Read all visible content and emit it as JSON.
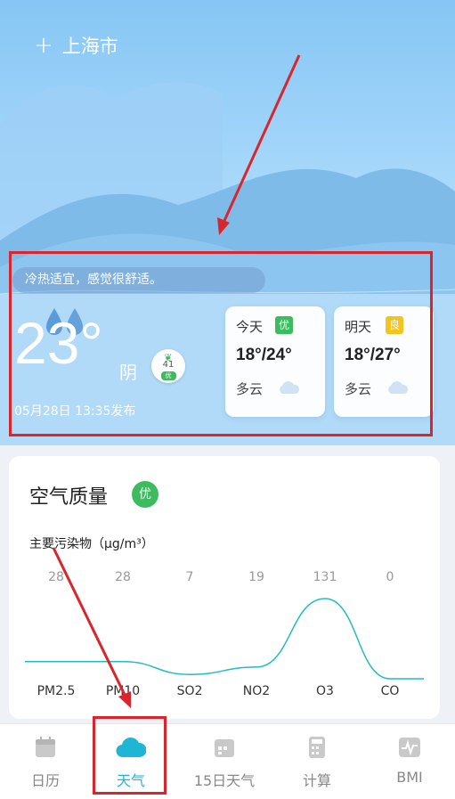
{
  "header": {
    "city": "上海市"
  },
  "current": {
    "tip": "冷热适宜，感觉很舒适。",
    "temperature": "23°",
    "condition": "阴",
    "aqi_value": "41",
    "aqi_level": "优",
    "publish_time": "05月28日 13:35发布"
  },
  "forecast": [
    {
      "day": "今天",
      "quality": "优",
      "quality_color": "#3dbb5f",
      "range": "18°/24°",
      "desc": "多云"
    },
    {
      "day": "明天",
      "quality": "良",
      "quality_color": "#f3c41b",
      "range": "18°/27°",
      "desc": "多云"
    }
  ],
  "air_quality": {
    "title": "空气质量",
    "level": "优",
    "subtitle": "主要污染物（μg/m³）",
    "pollutants": [
      {
        "name": "PM2.5",
        "value": 28
      },
      {
        "name": "PM10",
        "value": 28
      },
      {
        "name": "SO2",
        "value": 7
      },
      {
        "name": "NO2",
        "value": 19
      },
      {
        "name": "O3",
        "value": 131
      },
      {
        "name": "CO",
        "value": 0
      }
    ]
  },
  "tabs": [
    {
      "label": "日历",
      "icon": "calendar-icon"
    },
    {
      "label": "天气",
      "icon": "cloud-icon"
    },
    {
      "label": "15日天气",
      "icon": "calendar-grid-icon"
    },
    {
      "label": "计算",
      "icon": "calculator-icon"
    },
    {
      "label": "BMI",
      "icon": "pulse-icon"
    }
  ],
  "active_tab": 1,
  "colors": {
    "accent": "#1fb6d6",
    "good": "#3dbb5f",
    "moderate": "#f3c41b",
    "highlight": "#d8262c"
  }
}
